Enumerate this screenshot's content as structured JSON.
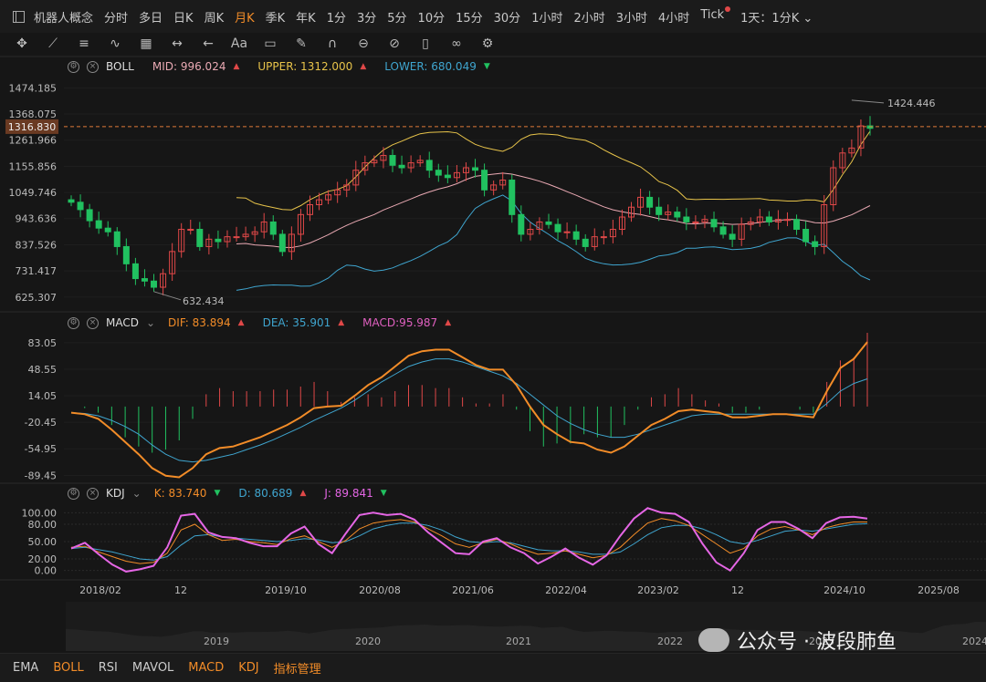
{
  "toolbar": {
    "symbol": "机器人概念",
    "periods": [
      "分时",
      "多日",
      "日K",
      "周K",
      "月K",
      "季K",
      "年K",
      "1分",
      "3分",
      "5分",
      "10分",
      "15分",
      "30分",
      "1小时",
      "2小时",
      "3小时",
      "4小时",
      "Tick"
    ],
    "active_period": "月K",
    "compare": "1天：1分K",
    "tools": [
      "move-icon",
      "line-icon",
      "fib-icon",
      "wave-icon",
      "grid-icon",
      "measure-icon",
      "arrow-icon",
      "text-icon",
      "comment-icon",
      "brush-icon",
      "magnet-icon",
      "lock-icon",
      "hide-icon",
      "delete-icon",
      "link-icon",
      "settings-icon"
    ],
    "text_tool": "Aa"
  },
  "boll": {
    "name": "BOLL",
    "mid_label": "MID: 996.024",
    "mid_color": "#e9a9b3",
    "upper_label": "UPPER: 1312.000",
    "upper_color": "#e7c34a",
    "lower_label": "LOWER: 680.049",
    "lower_color": "#3fa5cf",
    "last_price": "1316.830",
    "high_note": "1424.446",
    "low_note": "632.434",
    "yticks": [
      "1474.185",
      "1368.075",
      "1261.966",
      "1155.856",
      "1049.746",
      "943.636",
      "837.526",
      "731.417",
      "625.307"
    ]
  },
  "macd": {
    "name": "MACD",
    "dif_label": "DIF: 83.894",
    "dif_color": "#f28c28",
    "dea_label": "DEA: 35.901",
    "dea_color": "#3fa5cf",
    "macd_label": "MACD:95.987",
    "macd_color": "#e060c0",
    "yticks": [
      "83.05",
      "48.55",
      "14.05",
      "-20.45",
      "-54.95",
      "-89.45"
    ]
  },
  "kdj": {
    "name": "KDJ",
    "k_label": "K: 83.740",
    "k_color": "#f28c28",
    "d_label": "D: 80.689",
    "d_color": "#3fa5cf",
    "j_label": "J: 89.841",
    "j_color": "#e566e5",
    "yticks": [
      "100.00",
      "80.00",
      "50.00",
      "20.00",
      "0.00"
    ]
  },
  "xaxis": {
    "labels": [
      "2018/02",
      "12",
      "2019/10",
      "2020/08",
      "2021/06",
      "2022/04",
      "2023/02",
      "12",
      "2024/10",
      "2025/08"
    ],
    "overview_labels": [
      "2019",
      "2020",
      "2021",
      "2022",
      "2023",
      "2024"
    ]
  },
  "indicators": {
    "items": [
      "EMA",
      "BOLL",
      "RSI",
      "MAVOL",
      "MACD",
      "KDJ",
      "指标管理"
    ],
    "active": [
      "BOLL",
      "MACD",
      "KDJ",
      "指标管理"
    ]
  },
  "watermark": "公众号 · 波段肺鱼",
  "colors": {
    "up": "#e04848",
    "down": "#21c160",
    "bg": "#161616",
    "grid": "#262626"
  },
  "chart_data": [
    {
      "type": "candlestick",
      "title": "BOLL",
      "x_start": "2017/11",
      "x_end": "2025/01",
      "interval": "month",
      "y_range": [
        580,
        1520
      ],
      "close": [
        1010,
        980,
        935,
        905,
        890,
        830,
        760,
        700,
        690,
        665,
        720,
        810,
        900,
        900,
        830,
        860,
        850,
        870,
        870,
        880,
        890,
        930,
        880,
        810,
        880,
        960,
        1000,
        1020,
        1040,
        1060,
        1080,
        1140,
        1170,
        1180,
        1200,
        1160,
        1150,
        1170,
        1180,
        1140,
        1120,
        1110,
        1130,
        1150,
        1140,
        1060,
        1080,
        1100,
        960,
        880,
        900,
        930,
        920,
        890,
        890,
        860,
        830,
        870,
        870,
        900,
        950,
        990,
        1030,
        990,
        960,
        970,
        950,
        930,
        930,
        940,
        910,
        880,
        860,
        920,
        930,
        950,
        930,
        940,
        940,
        900,
        850,
        830,
        1000,
        1150,
        1210,
        1230,
        1320,
        1310
      ],
      "bb_upper_visible_from": "2019/06",
      "bb_lower_visible_from": "2019/06"
    },
    {
      "type": "line",
      "title": "MACD",
      "series": [
        {
          "name": "DIF",
          "values": [
            -8,
            -10,
            -16,
            -30,
            -46,
            -62,
            -80,
            -90,
            -92,
            -80,
            -62,
            -54,
            -52,
            -46,
            -40,
            -32,
            -24,
            -14,
            -2,
            0,
            1,
            14,
            28,
            38,
            52,
            66,
            72,
            74,
            74,
            64,
            54,
            48,
            48,
            28,
            0,
            -24,
            -36,
            -46,
            -48,
            -56,
            -60,
            -52,
            -38,
            -24,
            -16,
            -6,
            -4,
            -6,
            -8,
            -14,
            -14,
            -12,
            -10,
            -10,
            -12,
            -14,
            20,
            50,
            62,
            84
          ]
        },
        {
          "name": "DEA",
          "values": [
            -8,
            -9,
            -12,
            -18,
            -26,
            -36,
            -50,
            -62,
            -70,
            -72,
            -70,
            -66,
            -62,
            -56,
            -50,
            -43,
            -35,
            -27,
            -18,
            -10,
            -2,
            8,
            20,
            32,
            42,
            52,
            58,
            62,
            62,
            58,
            52,
            46,
            40,
            30,
            16,
            2,
            -12,
            -22,
            -30,
            -36,
            -40,
            -40,
            -36,
            -30,
            -24,
            -18,
            -12,
            -10,
            -10,
            -10,
            -10,
            -10,
            -10,
            -10,
            -10,
            -10,
            4,
            20,
            30,
            36
          ]
        }
      ],
      "histogram_name": "MACD",
      "y_range": [
        -95,
        90
      ]
    },
    {
      "type": "line",
      "title": "KDJ",
      "series": [
        {
          "name": "K",
          "values": [
            40,
            42,
            32,
            24,
            16,
            12,
            14,
            30,
            70,
            80,
            62,
            52,
            54,
            50,
            48,
            45,
            55,
            60,
            50,
            40,
            52,
            72,
            82,
            86,
            88,
            84,
            72,
            60,
            46,
            40,
            48,
            54,
            46,
            36,
            28,
            30,
            34,
            28,
            22,
            26,
            40,
            62,
            82,
            90,
            86,
            78,
            62,
            46,
            30,
            38,
            60,
            72,
            76,
            70,
            62,
            74,
            80,
            84,
            84
          ]
        },
        {
          "name": "D",
          "values": [
            38,
            40,
            36,
            32,
            26,
            20,
            18,
            24,
            44,
            60,
            62,
            58,
            56,
            54,
            52,
            50,
            52,
            55,
            53,
            48,
            50,
            60,
            72,
            78,
            82,
            82,
            78,
            70,
            58,
            50,
            48,
            50,
            48,
            42,
            36,
            34,
            34,
            32,
            28,
            28,
            32,
            46,
            62,
            74,
            78,
            78,
            72,
            62,
            50,
            46,
            52,
            60,
            68,
            70,
            68,
            72,
            76,
            80,
            81
          ]
        },
        {
          "name": "J",
          "values": [
            38,
            48,
            28,
            10,
            -2,
            2,
            8,
            40,
            95,
            98,
            66,
            58,
            56,
            48,
            42,
            42,
            64,
            76,
            46,
            30,
            64,
            96,
            100,
            96,
            98,
            88,
            66,
            48,
            30,
            28,
            50,
            56,
            40,
            30,
            12,
            24,
            38,
            22,
            10,
            26,
            60,
            90,
            108,
            100,
            98,
            84,
            46,
            14,
            0,
            30,
            70,
            84,
            84,
            72,
            56,
            82,
            92,
            93,
            90
          ]
        }
      ],
      "y_range": [
        -10,
        110
      ]
    }
  ]
}
